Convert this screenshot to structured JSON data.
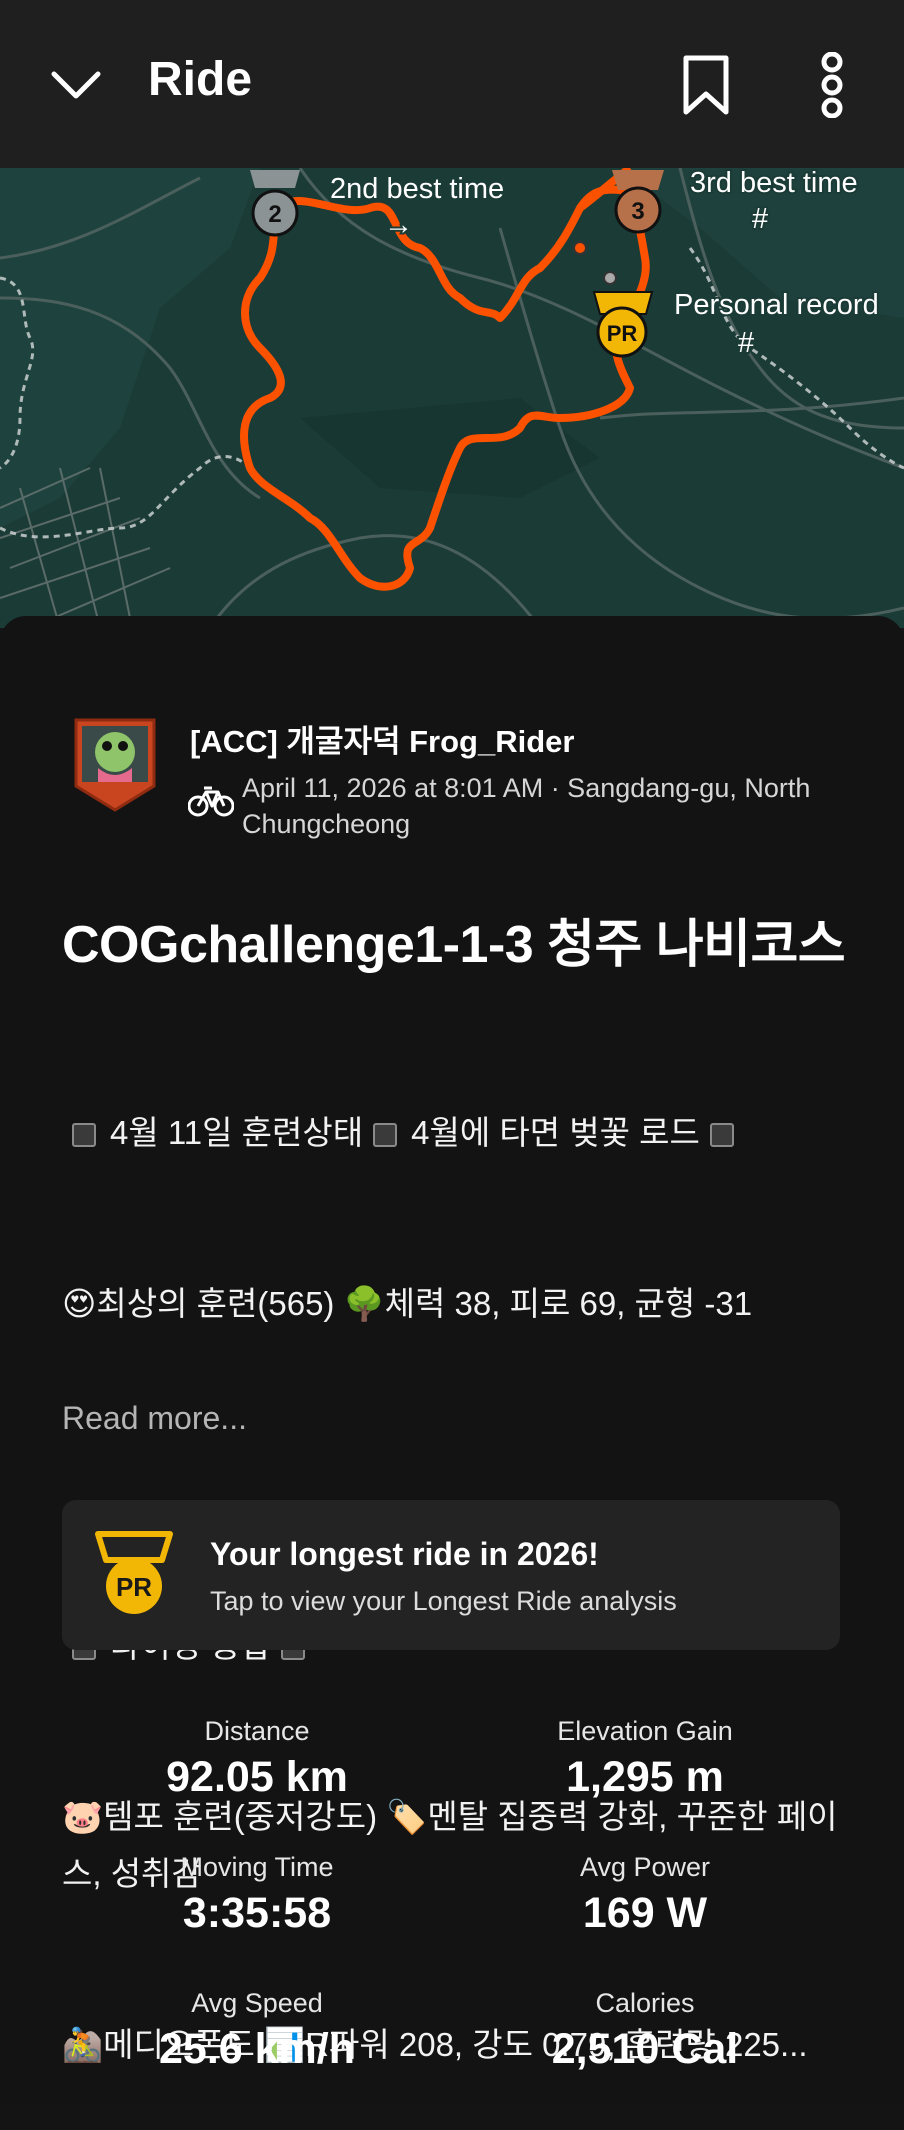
{
  "header": {
    "title": "Ride"
  },
  "map": {
    "labels": {
      "second": "2nd best time",
      "second_arrow": "→",
      "third": "3rd best time",
      "third_hash": "#",
      "pr": "Personal record",
      "pr_hash": "#"
    },
    "medals": {
      "second": "2",
      "third": "3",
      "pr": "PR"
    },
    "colors": {
      "route": "#fc5200",
      "land": "#1b3b36",
      "road": "#4b5f5c"
    }
  },
  "athlete": {
    "name": "[ACC] 개굴자덕 Frog_Rider",
    "datetime_location": "April 11, 2026 at 8:01 AM · Sangdang-gu, North Chungcheong"
  },
  "activity": {
    "title": "COGchallenge1-1-3 청주 나비코스",
    "desc": {
      "line1": "4월 11일 훈련상태",
      "line1b": "4월에 타면 벚꽃 로드",
      "line2": "😍최상의 훈련(565) 🌳체력 38, 피로 69, 균형 -31",
      "line3": "라이딩 종합",
      "line4": "🐷템포 훈련(중저강도) 🏷️멘탈 집중력 강화, 꾸준한 페이스, 성취감",
      "line5": "🚵메디오폰도 📊R파워 208, 강도 0.79, 훈련량 225..."
    },
    "read_more": "Read more..."
  },
  "achievement": {
    "medal": "PR",
    "title": "Your longest ride in 2026!",
    "subtitle": "Tap to view your Longest Ride analysis"
  },
  "stats": [
    {
      "label": "Distance",
      "value": "92.05 km"
    },
    {
      "label": "Elevation Gain",
      "value": "1,295 m"
    },
    {
      "label": "Moving Time",
      "value": "3:35:58"
    },
    {
      "label": "Avg Power",
      "value": "169 W"
    },
    {
      "label": "Avg Speed",
      "value": "25.6 km/h"
    },
    {
      "label": "Calories",
      "value": "2,510 Cal"
    }
  ]
}
